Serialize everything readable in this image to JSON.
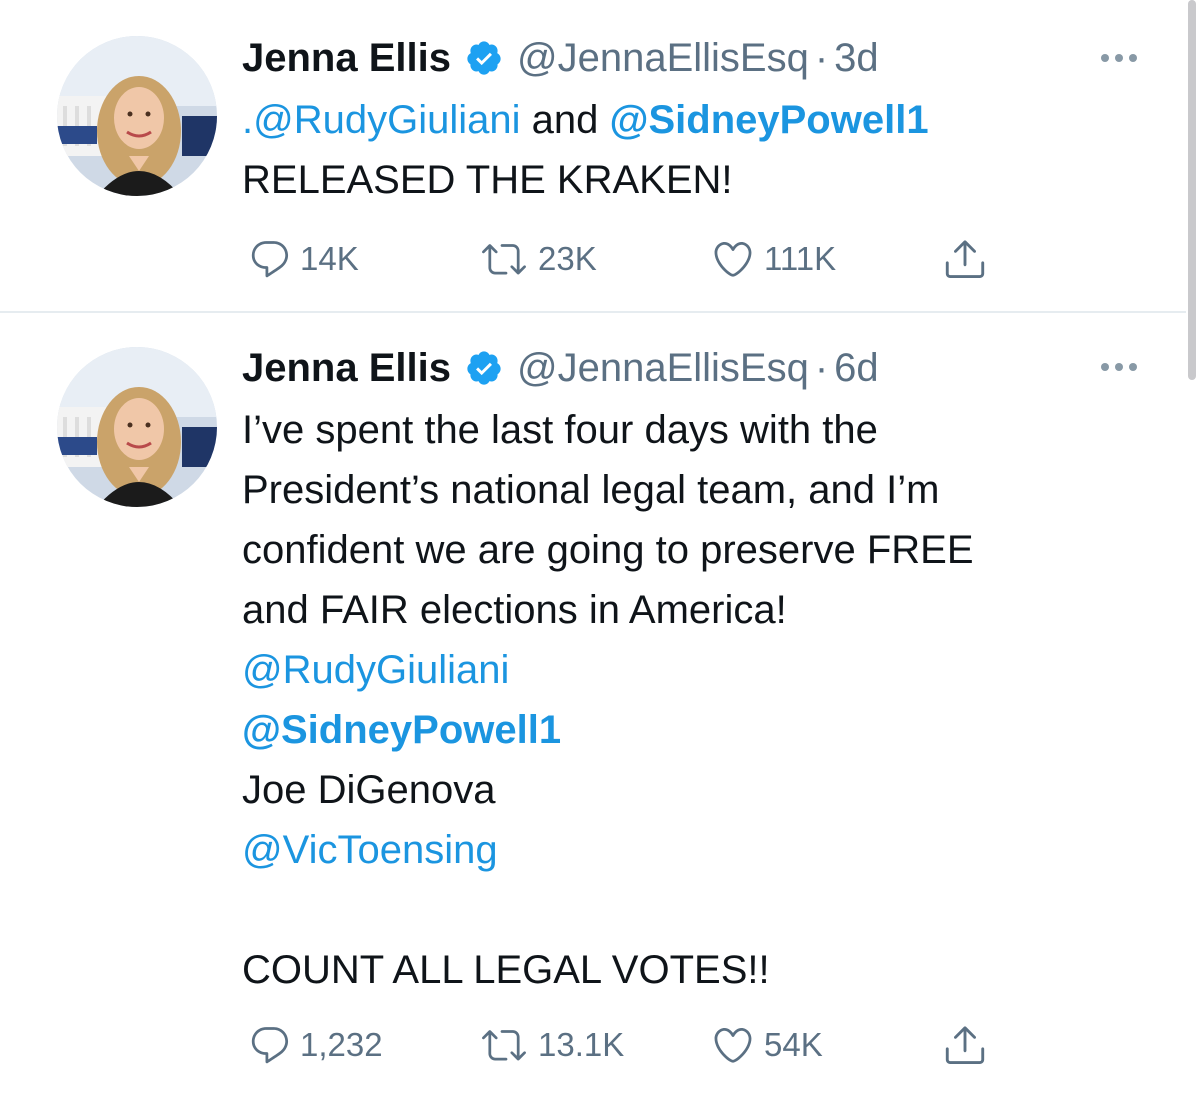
{
  "tweets": [
    {
      "name": "Jenna Ellis",
      "handle": "@JennaEllisEsq",
      "separator": "·",
      "time": "3d",
      "lines": [
        [
          {
            "text": ".@RudyGiuliani",
            "type": "mention"
          },
          {
            "text": " and ",
            "type": "text"
          },
          {
            "text": "@SidneyPowell1",
            "type": "mention-bold"
          }
        ],
        [
          {
            "text": "RELEASED THE KRAKEN!",
            "type": "text"
          }
        ]
      ],
      "stats": {
        "replies": "14K",
        "retweets": "23K",
        "likes": "111K"
      }
    },
    {
      "name": "Jenna Ellis",
      "handle": "@JennaEllisEsq",
      "separator": "·",
      "time": "6d",
      "lines": [
        [
          {
            "text": "I’ve spent the last four days with the",
            "type": "text"
          }
        ],
        [
          {
            "text": "President’s national legal team, and I’m",
            "type": "text"
          }
        ],
        [
          {
            "text": "confident we are going to preserve FREE",
            "type": "text"
          }
        ],
        [
          {
            "text": "and FAIR elections in America!",
            "type": "text"
          }
        ],
        [
          {
            "text": "@RudyGiuliani",
            "type": "mention"
          }
        ],
        [
          {
            "text": "@SidneyPowell1",
            "type": "mention-bold"
          }
        ],
        [
          {
            "text": "Joe DiGenova",
            "type": "text"
          }
        ],
        [
          {
            "text": "@VicToensing",
            "type": "mention"
          }
        ],
        [
          {
            "text": "",
            "type": "text"
          }
        ],
        [
          {
            "text": "COUNT ALL LEGAL VOTES!!",
            "type": "text"
          }
        ]
      ],
      "stats": {
        "replies": "1,232",
        "retweets": "13.1K",
        "likes": "54K"
      }
    }
  ],
  "icons": {
    "verified": "verified-badge-icon",
    "reply": "reply-bubble-icon",
    "retweet": "retweet-icon",
    "like": "heart-icon",
    "share": "share-icon",
    "more": "more-dots-icon"
  },
  "colors": {
    "link": "#1b95e0",
    "secondary": "#5b7083",
    "verified": "#1da1f2",
    "divider": "#e6ecf0"
  }
}
